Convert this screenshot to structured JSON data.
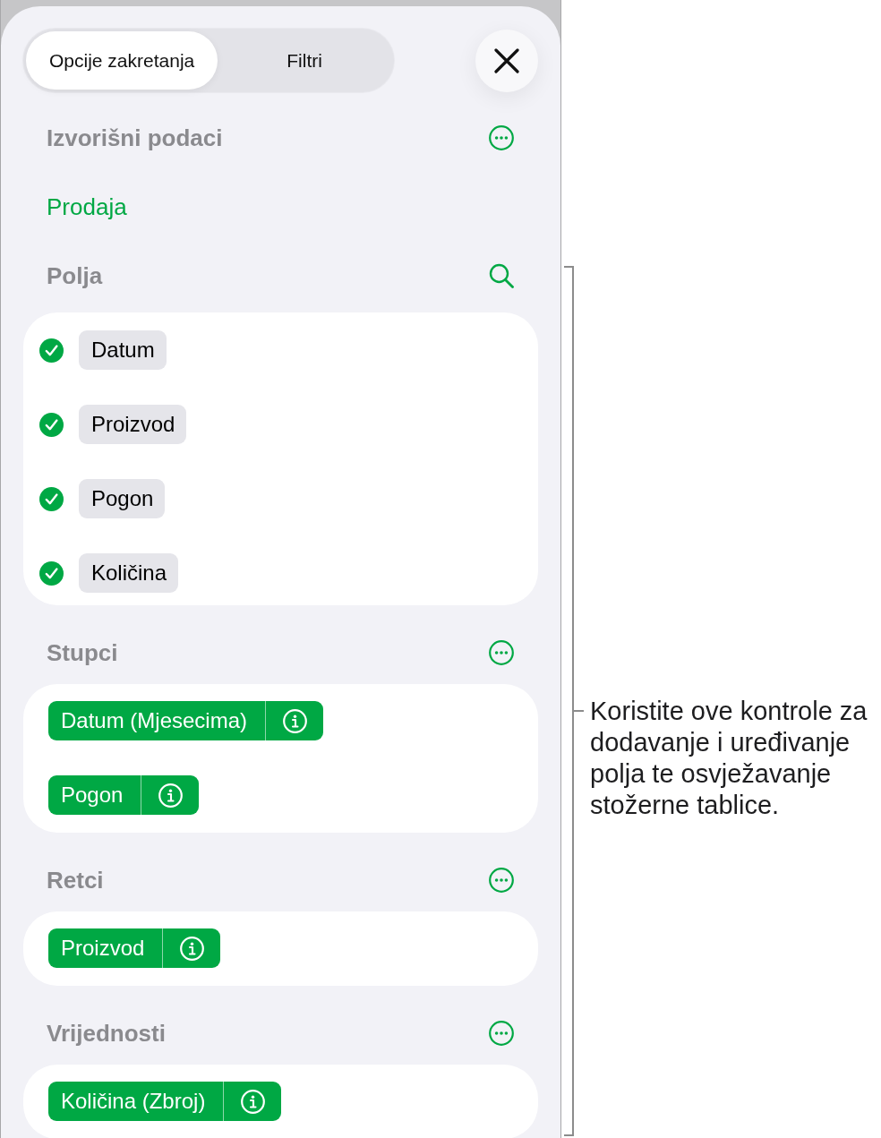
{
  "tabs": [
    {
      "label": "Opcije zakretanja",
      "selected": true
    },
    {
      "label": "Filtri",
      "selected": false
    }
  ],
  "sections": [
    {
      "kind": "source",
      "heading": "Izvorišni podaci",
      "value": "Prodaja"
    },
    {
      "kind": "fields",
      "heading": "Polja",
      "items": [
        {
          "label": "Datum",
          "checked": true
        },
        {
          "label": "Proizvod",
          "checked": true
        },
        {
          "label": "Pogon",
          "checked": true
        },
        {
          "label": "Količina",
          "checked": true
        }
      ]
    },
    {
      "kind": "pills",
      "heading": "Stupci",
      "items": [
        {
          "label": "Datum (Mjesecima)"
        },
        {
          "label": "Pogon"
        }
      ]
    },
    {
      "kind": "pills",
      "heading": "Retci",
      "items": [
        {
          "label": "Proizvod"
        }
      ]
    },
    {
      "kind": "pills",
      "heading": "Vrijednosti",
      "items": [
        {
          "label": "Količina (Zbroj)"
        }
      ]
    }
  ],
  "callout": {
    "text": "Koristite ove kontrole za dodavanje i uređivanje polja te osvježavanje stožerne tablice."
  }
}
